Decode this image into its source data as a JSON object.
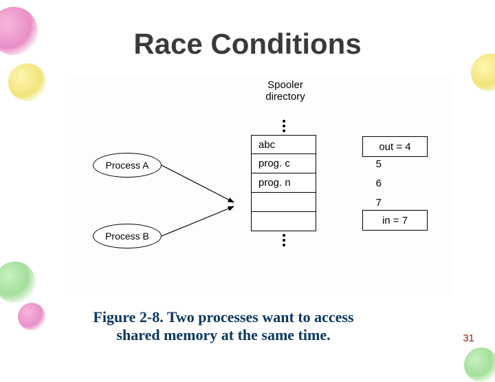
{
  "title": "Race Conditions",
  "diagram": {
    "spooler_label_l1": "Spooler",
    "spooler_label_l2": "directory",
    "slots": {
      "idx4": "4",
      "val4": "abc",
      "idx5": "5",
      "val5": "prog. c",
      "idx6": "6",
      "val6": "prog. n",
      "idx7": "7",
      "val7": ""
    },
    "processA": "Process A",
    "processB": "Process B",
    "out_label": "out = 4",
    "in_label": "in = 7"
  },
  "caption_l1": "Figure 2-8. Two processes want to access",
  "caption_l2": "shared memory at the same time.",
  "page_number": "31"
}
